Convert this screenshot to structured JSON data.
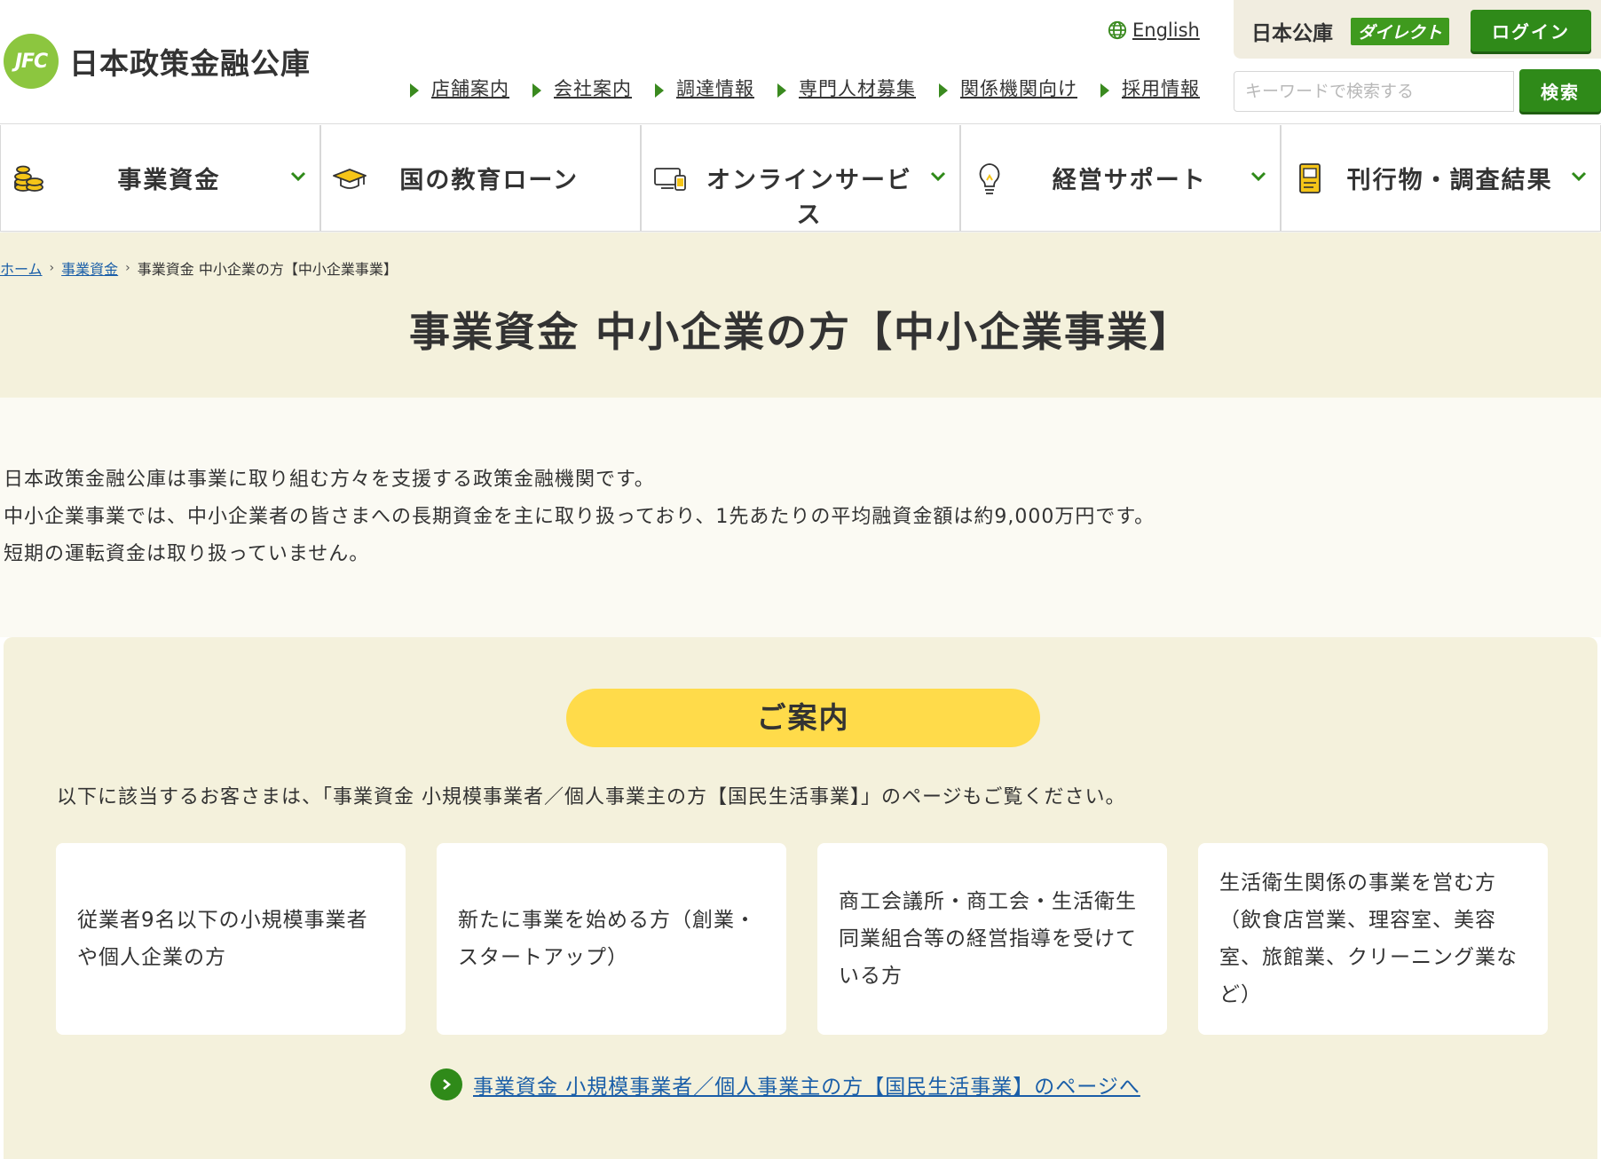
{
  "header": {
    "logo_mark": "JFC",
    "logo_text": "日本政策金融公庫",
    "lang_link": "English",
    "subnav": [
      {
        "label": "店舗案内"
      },
      {
        "label": "会社案内"
      },
      {
        "label": "調達情報"
      },
      {
        "label": "専門人材募集"
      },
      {
        "label": "関係機関向け"
      },
      {
        "label": "採用情報"
      }
    ],
    "direct": {
      "label": "日本公庫",
      "badge": "ダイレクト",
      "login_label": "ログイン"
    },
    "search": {
      "placeholder": "キーワードで検索する",
      "value": "",
      "button_label": "検索"
    }
  },
  "mainnav": [
    {
      "label": "事業資金",
      "icon": "coins-icon",
      "has_dropdown": true
    },
    {
      "label": "国の教育ローン",
      "icon": "graduation-cap-icon",
      "has_dropdown": false
    },
    {
      "label": "オンラインサービス",
      "icon": "devices-icon",
      "has_dropdown": true
    },
    {
      "label": "経営サポート",
      "icon": "lightbulb-icon",
      "has_dropdown": true
    },
    {
      "label": "刊行物・調査結果",
      "icon": "document-icon",
      "has_dropdown": true
    }
  ],
  "breadcrumb": [
    {
      "label": "ホーム"
    },
    {
      "label": "事業資金"
    },
    {
      "label": "事業資金 中小企業の方【中小企業事業】"
    }
  ],
  "page_title": "事業資金 中小企業の方【中小企業事業】",
  "intro": {
    "lines": [
      "日本政策金融公庫は事業に取り組む方々を支援する政策金融機関です。",
      "中小企業事業では、中小企業者の皆さまへの長期資金を主に取り扱っており、1先あたりの平均融資金額は約9,000万円です。",
      "短期の運転資金は取り扱っていません。"
    ]
  },
  "guide": {
    "pill_label": "ご案内",
    "text": "以下に該当するお客さまは、「事業資金 小規模事業者／個人事業主の方【国民生活事業】」のページもご覧ください。",
    "cards": [
      {
        "text": "従業者9名以下の小規模事業者や個人企業の方"
      },
      {
        "text": "新たに事業を始める方（創業・スタートアップ）"
      },
      {
        "text": "商工会議所・商工会・生活衛生同業組合等の経営指導を受けている方"
      },
      {
        "text": "生活衛生関係の事業を営む方（飲食店営業、理容室、美容室、旅館業、クリーニング業など）"
      }
    ],
    "link_label": "事業資金 小規模事業者／個人事業主の方【国民生活事業】のページへ"
  },
  "colors": {
    "accent_green": "#2f8a19",
    "logo_green": "#8cc63f",
    "band_beige": "#f4f1dc",
    "pill_yellow": "#ffdb4a",
    "link_blue": "#1a5ea8"
  }
}
